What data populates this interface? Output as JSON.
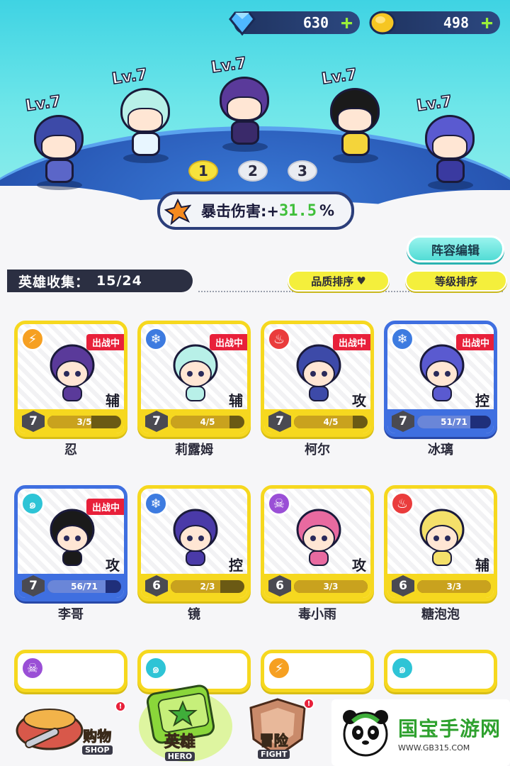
{
  "currency": {
    "gems": "630",
    "coins": "498",
    "plus": "+"
  },
  "team": {
    "heroes": [
      {
        "level": "Lv.7"
      },
      {
        "level": "Lv.7"
      },
      {
        "level": "Lv.7"
      },
      {
        "level": "Lv.7"
      },
      {
        "level": "Lv.7"
      }
    ],
    "pages": [
      "1",
      "2",
      "3"
    ],
    "active_page": 1,
    "bonus_label": "暴击伤害:+",
    "bonus_value": "31.5",
    "bonus_unit": "%",
    "lineup_button": "阵容编辑"
  },
  "collection": {
    "label": "英雄收集：",
    "count": "15/24",
    "sort_quality": "品质排序",
    "sort_level": "等级排序"
  },
  "heroes": [
    {
      "name": "忍",
      "element": "thunder",
      "in_battle": "出战中",
      "role": "辅",
      "stars": "7",
      "progress": "3/5",
      "fill": 0.6,
      "frame": "gold"
    },
    {
      "name": "莉露姆",
      "element": "ice",
      "in_battle": "出战中",
      "role": "辅",
      "stars": "7",
      "progress": "4/5",
      "fill": 0.8,
      "frame": "gold"
    },
    {
      "name": "柯尔",
      "element": "fire",
      "in_battle": "出战中",
      "role": "攻",
      "stars": "7",
      "progress": "4/5",
      "fill": 0.8,
      "frame": "gold"
    },
    {
      "name": "冰璃",
      "element": "ice",
      "in_battle": "出战中",
      "role": "控",
      "stars": "7",
      "progress": "51/71",
      "fill": 0.72,
      "frame": "blue"
    },
    {
      "name": "李哥",
      "element": "wind",
      "in_battle": "出战中",
      "role": "攻",
      "stars": "7",
      "progress": "56/71",
      "fill": 0.79,
      "frame": "blue"
    },
    {
      "name": "镜",
      "element": "ice",
      "in_battle": "",
      "role": "控",
      "stars": "6",
      "progress": "2/3",
      "fill": 0.67,
      "frame": "gold"
    },
    {
      "name": "毒小雨",
      "element": "poison",
      "in_battle": "",
      "role": "攻",
      "stars": "6",
      "progress": "3/3",
      "fill": 1.0,
      "frame": "gold"
    },
    {
      "name": "糖泡泡",
      "element": "fire",
      "in_battle": "",
      "role": "辅",
      "stars": "6",
      "progress": "3/3",
      "fill": 1.0,
      "frame": "gold"
    }
  ],
  "nav": {
    "shop": {
      "label": "购物",
      "sub": "SHOP"
    },
    "hero": {
      "label": "英雄",
      "sub": "HERO"
    },
    "fight": {
      "label": "冒险",
      "sub": "FIGHT"
    },
    "badge": "!"
  },
  "watermark": {
    "name": "国宝手游网",
    "url": "WWW.GB315.COM"
  },
  "colors": {
    "gold_frame": "#f6d81f",
    "blue_frame": "#3f6fe0",
    "battle_tag": "#e8203a",
    "accent_green": "#9bef3a"
  }
}
